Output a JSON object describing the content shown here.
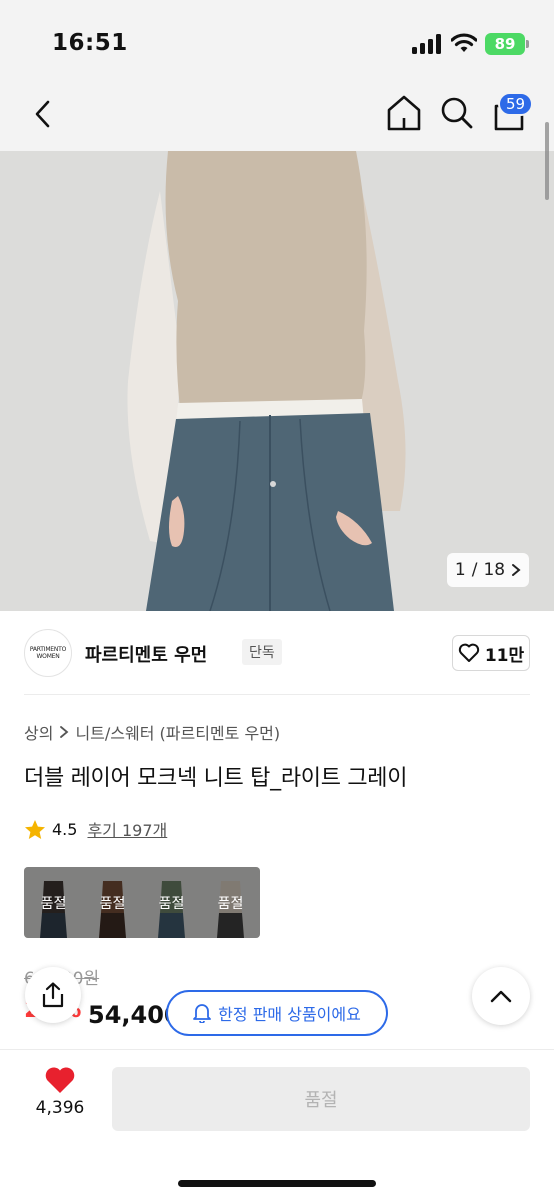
{
  "status_bar": {
    "time": "16:51",
    "battery": "89"
  },
  "nav": {
    "cart_count": "59",
    "icons": [
      "back-icon",
      "home-icon",
      "search-icon",
      "cart-icon"
    ]
  },
  "gallery": {
    "current": "1",
    "total": "18",
    "separator": "/"
  },
  "brand": {
    "logo_line1": "PARTIMENTO",
    "logo_line2": "WOMEN",
    "name": "파르티멘토 우먼",
    "tag": "단독",
    "like_count": "11만"
  },
  "breadcrumb": {
    "level1": "상의",
    "level2": "니트/스웨터 (파르티멘토 우먼)"
  },
  "product": {
    "title": "더블 레이어 모크넥 니트 탑_라이트 그레이",
    "rating": "4.5",
    "reviews": "후기 197개"
  },
  "colors": [
    {
      "label": "품절",
      "tone": "#3a3330"
    },
    {
      "label": "품절",
      "tone": "#6e4a34"
    },
    {
      "label": "품절",
      "tone": "#667a62"
    },
    {
      "label": "품절",
      "tone": "#cfc5b8"
    }
  ],
  "price": {
    "original": "68,000원",
    "discount": "20%",
    "sale": "54,400원"
  },
  "toast": {
    "text": "한정 판매 상품이에요"
  },
  "bottom": {
    "wish_count": "4,396",
    "button_label": "품절"
  },
  "theme": {
    "accent": "#2d6ae8",
    "discount_red": "#ff3b3b",
    "heart": "#e8212e",
    "star": "#f5b400"
  }
}
